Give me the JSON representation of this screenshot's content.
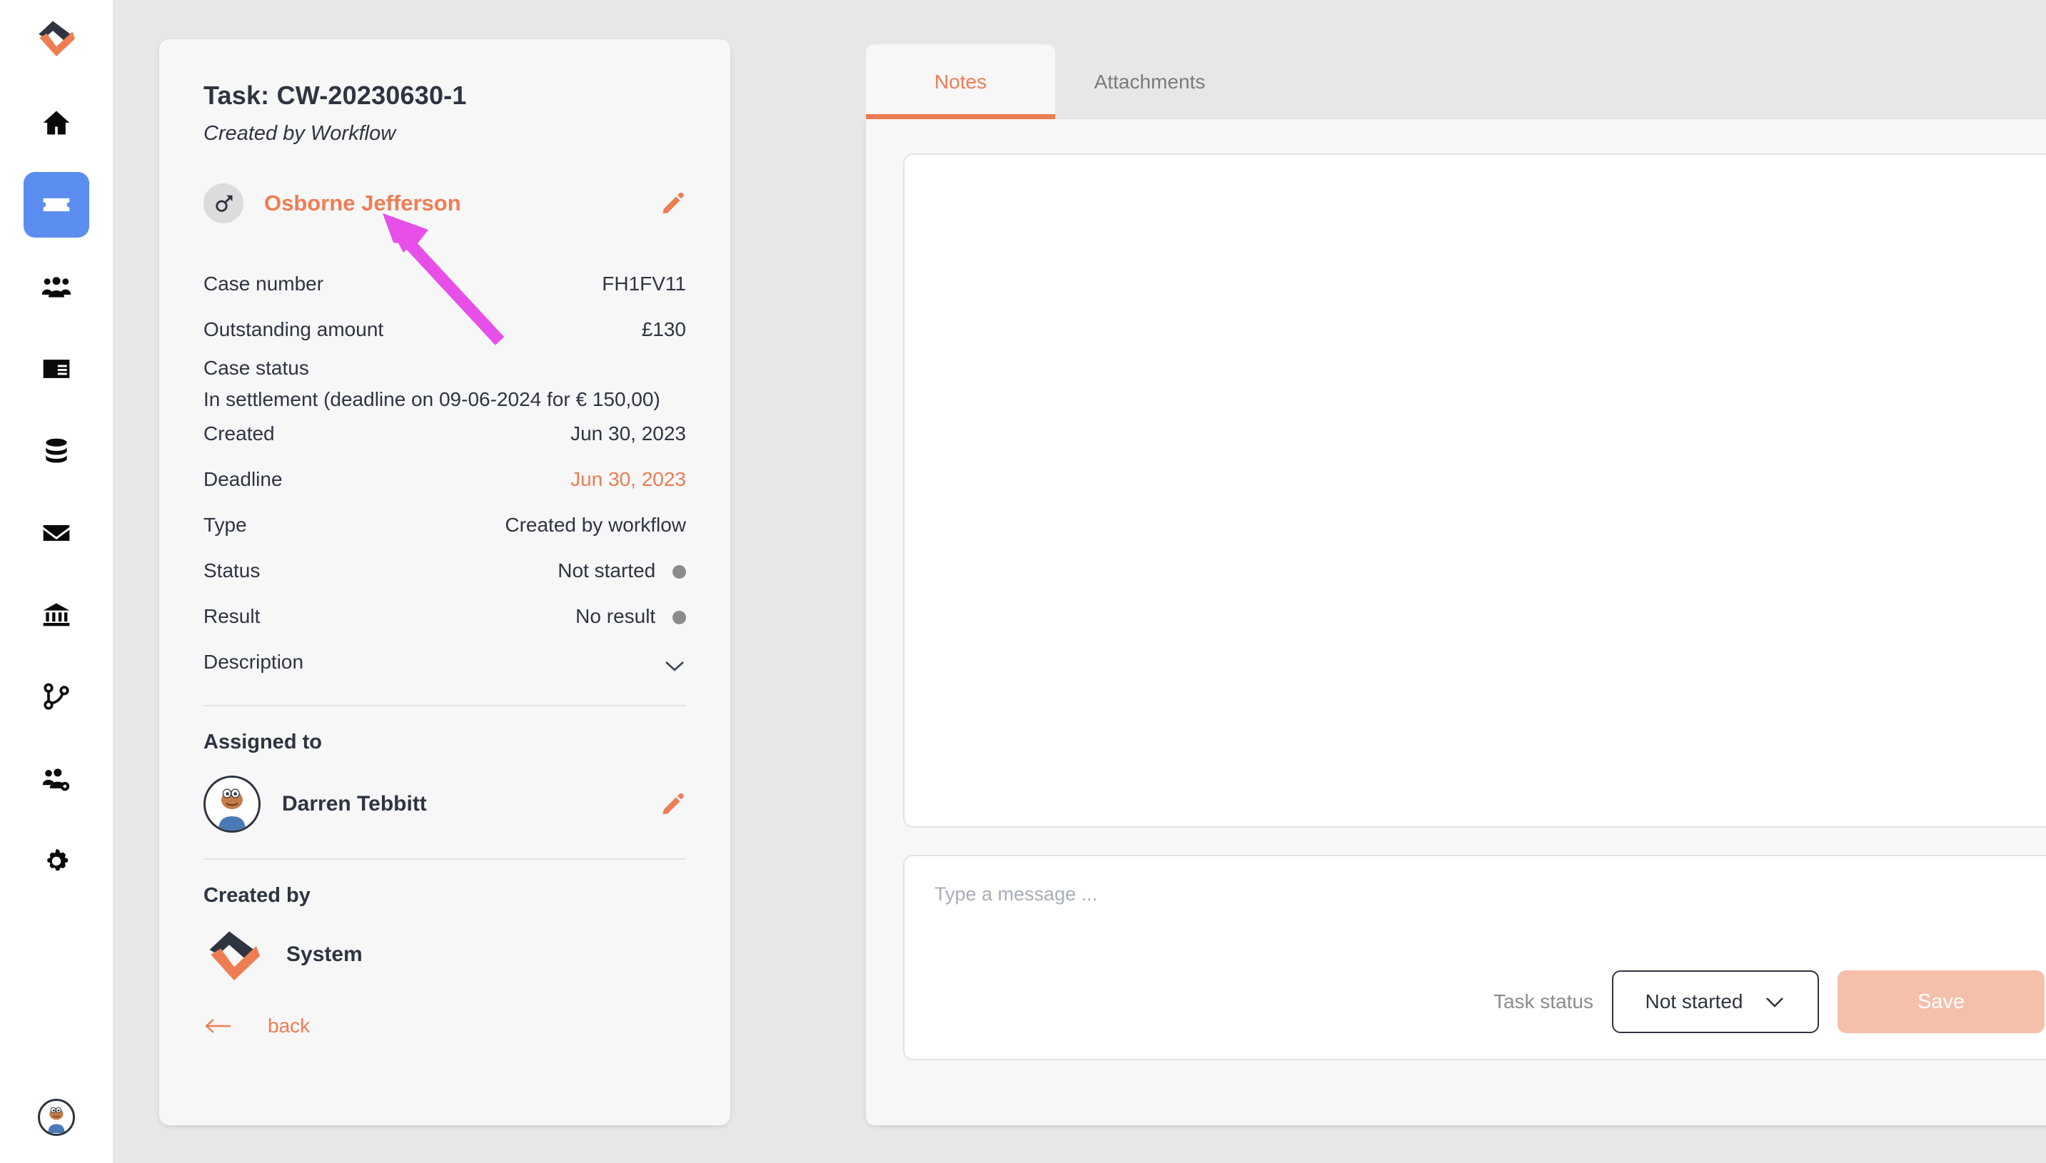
{
  "sidebar": {
    "brand_icon": "app-logo-icon",
    "items": [
      {
        "icon": "home-icon",
        "name": "home",
        "active": false
      },
      {
        "icon": "ticket-icon",
        "name": "tickets",
        "active": true
      },
      {
        "icon": "users-icon",
        "name": "customers",
        "active": false
      },
      {
        "icon": "id-card-icon",
        "name": "contacts",
        "active": false
      },
      {
        "icon": "database-icon",
        "name": "data",
        "active": false
      },
      {
        "icon": "envelope-icon",
        "name": "mail",
        "active": false
      },
      {
        "icon": "bank-icon",
        "name": "finance",
        "active": false
      },
      {
        "icon": "branch-icon",
        "name": "workflows",
        "active": false
      },
      {
        "icon": "users-gear-icon",
        "name": "team-settings",
        "active": false
      },
      {
        "icon": "gear-icon",
        "name": "settings",
        "active": false
      }
    ],
    "avatar_icon": "user-avatar"
  },
  "task": {
    "title": "Task: CW-20230630-1",
    "subtitle": "Created by Workflow",
    "person": {
      "gender_icon": "male-icon",
      "name": "Osborne Jefferson",
      "edit_icon": "pencil-icon"
    },
    "details": [
      {
        "label": "Case number",
        "value": "FH1FV11",
        "accent": false,
        "dot": false,
        "stacked": false
      },
      {
        "label": "Outstanding amount",
        "value": "£130",
        "accent": false,
        "dot": false,
        "stacked": false
      },
      {
        "label": "Case status",
        "value": "In settlement (deadline on 09-06-2024 for € 150,00)",
        "accent": false,
        "dot": false,
        "stacked": true
      },
      {
        "label": "Created",
        "value": "Jun 30, 2023",
        "accent": false,
        "dot": false,
        "stacked": false
      },
      {
        "label": "Deadline",
        "value": "Jun 30, 2023",
        "accent": true,
        "dot": false,
        "stacked": false
      },
      {
        "label": "Type",
        "value": "Created by workflow",
        "accent": false,
        "dot": false,
        "stacked": false
      },
      {
        "label": "Status",
        "value": "Not started",
        "accent": false,
        "dot": true,
        "stacked": false
      },
      {
        "label": "Result",
        "value": "No result",
        "accent": false,
        "dot": true,
        "stacked": false
      }
    ],
    "description_label": "Description",
    "description_toggle_icon": "chevron-down-icon",
    "assigned_to": {
      "heading": "Assigned to",
      "name": "Darren Tebbitt",
      "edit_icon": "pencil-icon"
    },
    "created_by": {
      "heading": "Created by",
      "name": "System",
      "logo_icon": "app-logo-icon"
    },
    "back": {
      "label": "back",
      "icon": "arrow-left-icon"
    }
  },
  "right_panel": {
    "tabs": [
      {
        "label": "Notes",
        "active": true
      },
      {
        "label": "Attachments",
        "active": false
      }
    ],
    "composer": {
      "placeholder": "Type a message ...",
      "value": "",
      "status_label": "Task status",
      "status_value": "Not started",
      "status_chevron_icon": "chevron-down-icon",
      "save_label": "Save"
    }
  },
  "annotation": {
    "type": "arrow",
    "color": "#e84fe8",
    "points_to": "Osborne Jefferson"
  },
  "colors": {
    "accent": "#ef7d52",
    "active_nav": "#5b8def",
    "page_bg": "#e7e7e7",
    "card_bg": "#f7f7f8",
    "text": "#2e3440",
    "muted": "#8c8c8c",
    "save_disabled": "#f4c0ab",
    "annotation": "#e84fe8"
  }
}
